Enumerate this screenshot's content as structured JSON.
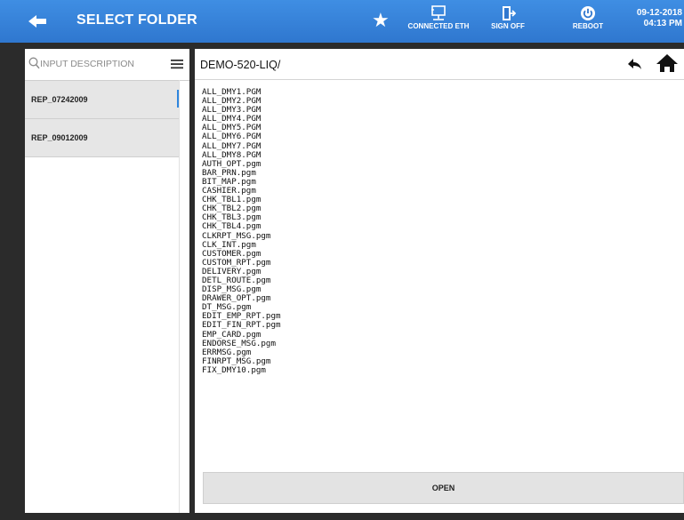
{
  "header": {
    "title": "SELECT FOLDER",
    "buttons": {
      "connected": "CONNECTED ETH",
      "sign_off": "SIGN OFF",
      "reboot": "REBOOT"
    },
    "date": "09-12-2018",
    "time": "04:13 PM"
  },
  "sidebar": {
    "search_placeholder": "INPUT DESCRIPTION",
    "folders": [
      {
        "label": "REP_07242009",
        "selected": true
      },
      {
        "label": "REP_09012009",
        "selected": false
      }
    ]
  },
  "main": {
    "path": "DEMO-520-LIQ/",
    "files": [
      "ALL_DMY1.PGM",
      "ALL_DMY2.PGM",
      "ALL_DMY3.PGM",
      "ALL_DMY4.PGM",
      "ALL_DMY5.PGM",
      "ALL_DMY6.PGM",
      "ALL_DMY7.PGM",
      "ALL_DMY8.PGM",
      "AUTH_OPT.pgm",
      "BAR_PRN.pgm",
      "BIT_MAP.pgm",
      "CASHIER.pgm",
      "CHK_TBL1.pgm",
      "CHK_TBL2.pgm",
      "CHK_TBL3.pgm",
      "CHK_TBL4.pgm",
      "CLKRPT_MSG.pgm",
      "CLK_INT.pgm",
      "CUSTOMER.pgm",
      "CUSTOM_RPT.pgm",
      "DELIVERY.pgm",
      "DETL_ROUTE.pgm",
      "DISP_MSG.pgm",
      "DRAWER_OPT.pgm",
      "DT_MSG.pgm",
      "EDIT_EMP_RPT.pgm",
      "EDIT_FIN_RPT.pgm",
      "EMP_CARD.pgm",
      "ENDORSE_MSG.pgm",
      "ERRMSG.pgm",
      "FINRPT_MSG.pgm",
      "FIX_DMY10.pgm"
    ],
    "open_label": "OPEN"
  },
  "colors": {
    "header_bg": "#3483d8",
    "accent": "#2e86de",
    "frame": "#2b2b2b"
  },
  "icons": [
    "back-arrow-icon",
    "star-icon",
    "network-icon",
    "sign-off-icon",
    "power-icon",
    "search-icon",
    "menu-icon",
    "undo-icon",
    "home-icon"
  ]
}
